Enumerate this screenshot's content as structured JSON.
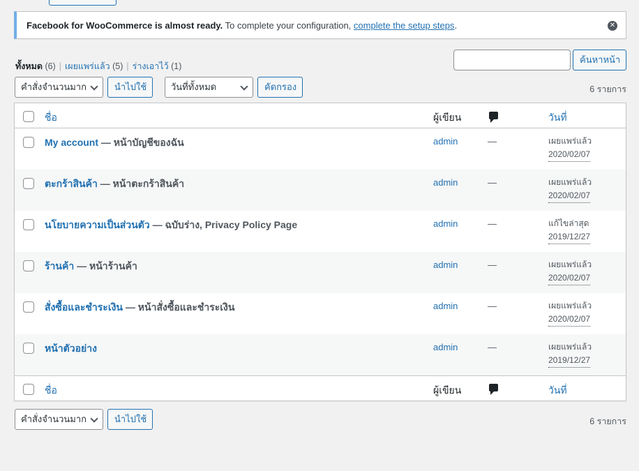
{
  "notice": {
    "bold": "Facebook for WooCommerce is almost ready.",
    "text": " To complete your configuration, ",
    "link": "complete the setup steps",
    "end": "."
  },
  "views": {
    "all": {
      "label": "ทั้งหมด",
      "count": "(6)"
    },
    "published": {
      "label": "เผยแพร่แล้ว",
      "count": "(5)"
    },
    "draft": {
      "label": "ร่างเอาไว้",
      "count": "(1)"
    },
    "separator": "|"
  },
  "search": {
    "input_value": "",
    "button": "ค้นหาหน้า"
  },
  "top_nav": {
    "bulk_action": "คำสั่งจำนวนมาก",
    "apply": "นำไปใช้",
    "date_filter": "วันที่ทั้งหมด",
    "filter": "คัดกรอง",
    "items_count": "6 รายการ"
  },
  "columns": {
    "title": "ชื่อ",
    "author": "ผู้เขียน",
    "date": "วันที่"
  },
  "rows": [
    {
      "title": "My account",
      "state": " — หน้าบัญชีของฉัน",
      "author": "admin",
      "comments": "—",
      "status": "เผยแพร่แล้ว",
      "date": "2020/02/07"
    },
    {
      "title": "ตะกร้าสินค้า",
      "state": " — หน้าตะกร้าสินค้า",
      "author": "admin",
      "comments": "—",
      "status": "เผยแพร่แล้ว",
      "date": "2020/02/07"
    },
    {
      "title": "นโยบายความเป็นส่วนตัว",
      "state": " — ฉบับร่าง, Privacy Policy Page",
      "author": "admin",
      "comments": "—",
      "status": "แก้ไขล่าสุด",
      "date": "2019/12/27"
    },
    {
      "title": "ร้านค้า",
      "state": " — หน้าร้านค้า",
      "author": "admin",
      "comments": "—",
      "status": "เผยแพร่แล้ว",
      "date": "2020/02/07"
    },
    {
      "title": "สั่งซื้อและชำระเงิน",
      "state": " — หน้าสั่งซื้อและชำระเงิน",
      "author": "admin",
      "comments": "—",
      "status": "เผยแพร่แล้ว",
      "date": "2020/02/07"
    },
    {
      "title": "หน้าตัวอย่าง",
      "state": "",
      "author": "admin",
      "comments": "—",
      "status": "เผยแพร่แล้ว",
      "date": "2019/12/27"
    }
  ],
  "bottom_nav": {
    "bulk_action": "คำสั่งจำนวนมาก",
    "apply": "นำไปใช้",
    "items_count": "6 รายการ"
  }
}
